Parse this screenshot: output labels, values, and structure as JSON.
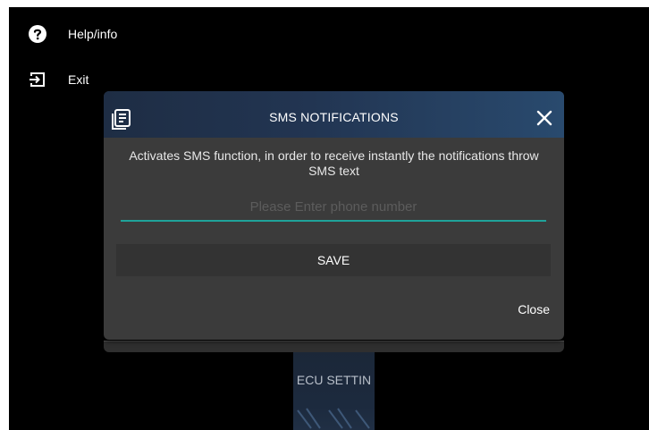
{
  "menu": {
    "items": [
      {
        "label": "Help/info",
        "icon": "help-circle-icon"
      },
      {
        "label": "Exit",
        "icon": "exit-icon"
      }
    ]
  },
  "dialog": {
    "header_icon": "document-list-icon",
    "title": "SMS NOTIFICATIONS",
    "close_icon": "close-icon",
    "description": "Activates SMS function, in order to receive instantly the notifications throw SMS text",
    "phone_input": {
      "value": "",
      "placeholder": "Please Enter phone number"
    },
    "save_label": "SAVE",
    "close_label": "Close"
  },
  "background_tile": {
    "label": "ECU SETTIN"
  },
  "colors": {
    "background": "#000000",
    "dialog": "#3b3b3b",
    "header_gradient_start": "#1e2d44",
    "header_gradient_end": "#294a6e",
    "input_underline": "#1fa39a",
    "save_button": "#333333"
  }
}
